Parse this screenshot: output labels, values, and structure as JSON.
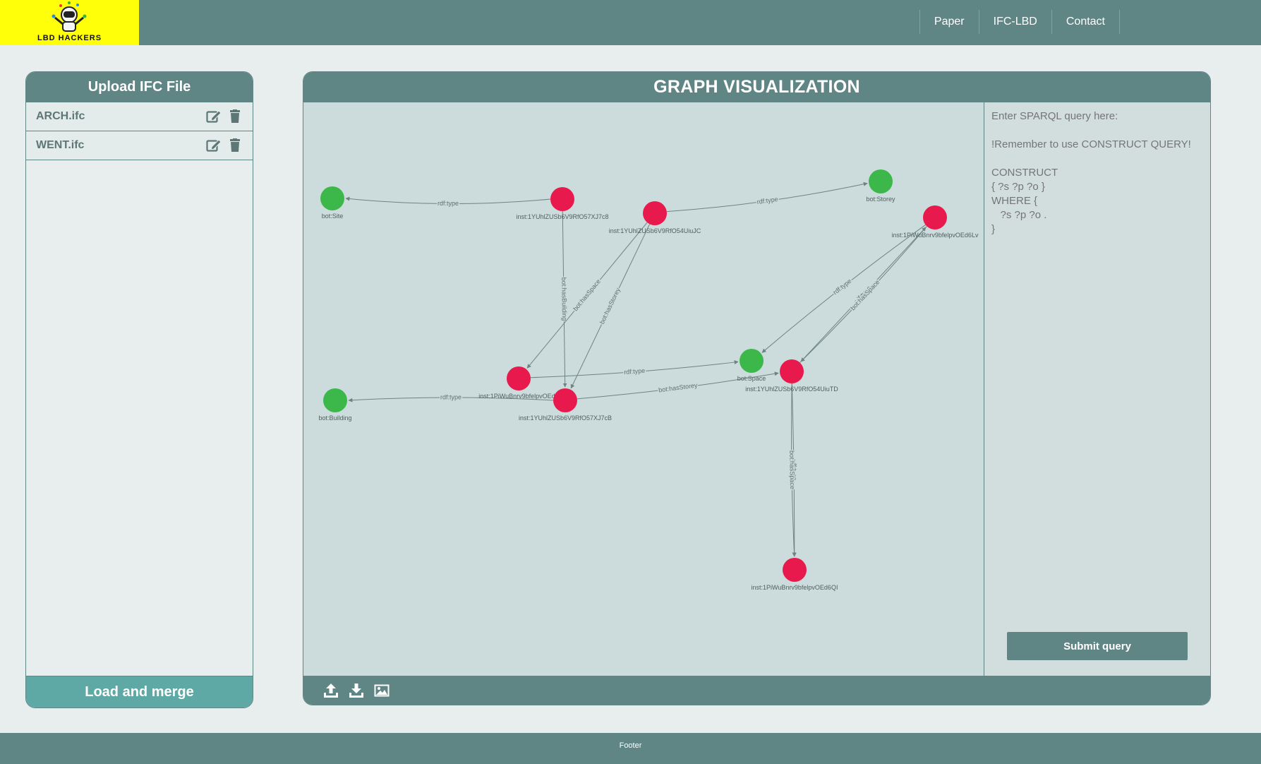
{
  "brand": {
    "logo_text": "LBD HACKERS",
    "logo_bg": "#ffff0a"
  },
  "nav": [
    {
      "label": "Paper"
    },
    {
      "label": "IFC-LBD"
    },
    {
      "label": "Contact"
    }
  ],
  "upload_panel": {
    "title": "Upload IFC File",
    "files": [
      {
        "name": "ARCH.ifc",
        "icons": [
          "edit-icon",
          "trash-icon"
        ]
      },
      {
        "name": "WENT.ifc",
        "icons": [
          "edit-icon",
          "trash-icon"
        ]
      }
    ],
    "load_button": "Load and merge"
  },
  "graph_panel": {
    "title": "GRAPH VISUALIZATION",
    "colors": {
      "class_node": "#3cb84a",
      "instance_node": "#e8194d",
      "edge": "#6f8282"
    },
    "nodes": [
      {
        "id": "site",
        "label": "bot:Site",
        "kind": "class"
      },
      {
        "id": "storey",
        "label": "bot:Storey",
        "kind": "class"
      },
      {
        "id": "building",
        "label": "bot:Building",
        "kind": "class"
      },
      {
        "id": "space",
        "label": "bot:Space",
        "kind": "class"
      },
      {
        "id": "n1",
        "label": "inst:1YUhlZUSb6V9RfO57XJ7c8",
        "kind": "instance"
      },
      {
        "id": "n2",
        "label": "inst:1YUhlZUSb6V9RfO54UiuJC",
        "kind": "instance"
      },
      {
        "id": "n3",
        "label": "inst:1PiWuBnrv9bfelpvOEd6Lv",
        "kind": "instance"
      },
      {
        "id": "n4",
        "label": "inst:1PiWuBnrv9bfelpvOEd6",
        "kind": "instance"
      },
      {
        "id": "n5",
        "label": "inst:1YUhlZUSb6V9RfO57XJ7cB",
        "kind": "instance"
      },
      {
        "id": "n6",
        "label": "inst:1YUhlZUSb6V9RfO54UiuTD",
        "kind": "instance"
      },
      {
        "id": "n7",
        "label": "inst:1PiWuBnrv9bfelpvOEd6QI",
        "kind": "instance"
      }
    ],
    "edges": [
      {
        "from": "n1",
        "to": "site",
        "label": "rdf:type"
      },
      {
        "from": "n2",
        "to": "storey",
        "label": "rdf:type"
      },
      {
        "from": "n1",
        "to": "n5",
        "label": "bot:hasBuilding"
      },
      {
        "from": "n2",
        "to": "n4",
        "label": "bot:hasSpace"
      },
      {
        "from": "n2",
        "to": "n5",
        "label": "bot:hasStorey"
      },
      {
        "from": "n3",
        "to": "space",
        "label": "rdf:type"
      },
      {
        "from": "n6",
        "to": "n3",
        "label": "rdf:type"
      },
      {
        "from": "n3",
        "to": "n6",
        "label": "bot:hasSpace"
      },
      {
        "from": "n4",
        "to": "space",
        "label": "rdf:type"
      },
      {
        "from": "n5",
        "to": "building",
        "label": "rdf:type"
      },
      {
        "from": "n5",
        "to": "n6",
        "label": "bot:hasStorey"
      },
      {
        "from": "n6",
        "to": "n7",
        "label": "rdf:type"
      },
      {
        "from": "n6",
        "to": "n7",
        "label": "bot:hasSpace"
      }
    ],
    "query": {
      "placeholder": "Enter SPARQL query here:\n\n!Remember to use CONSTRUCT QUERY!\n\nCONSTRUCT\n{ ?s ?p ?o }\nWHERE {\n   ?s ?p ?o .\n}",
      "submit_label": "Submit query"
    },
    "tools": [
      {
        "name": "upload-icon"
      },
      {
        "name": "download-icon"
      },
      {
        "name": "image-icon"
      }
    ]
  },
  "footer": {
    "text": "Footer"
  }
}
